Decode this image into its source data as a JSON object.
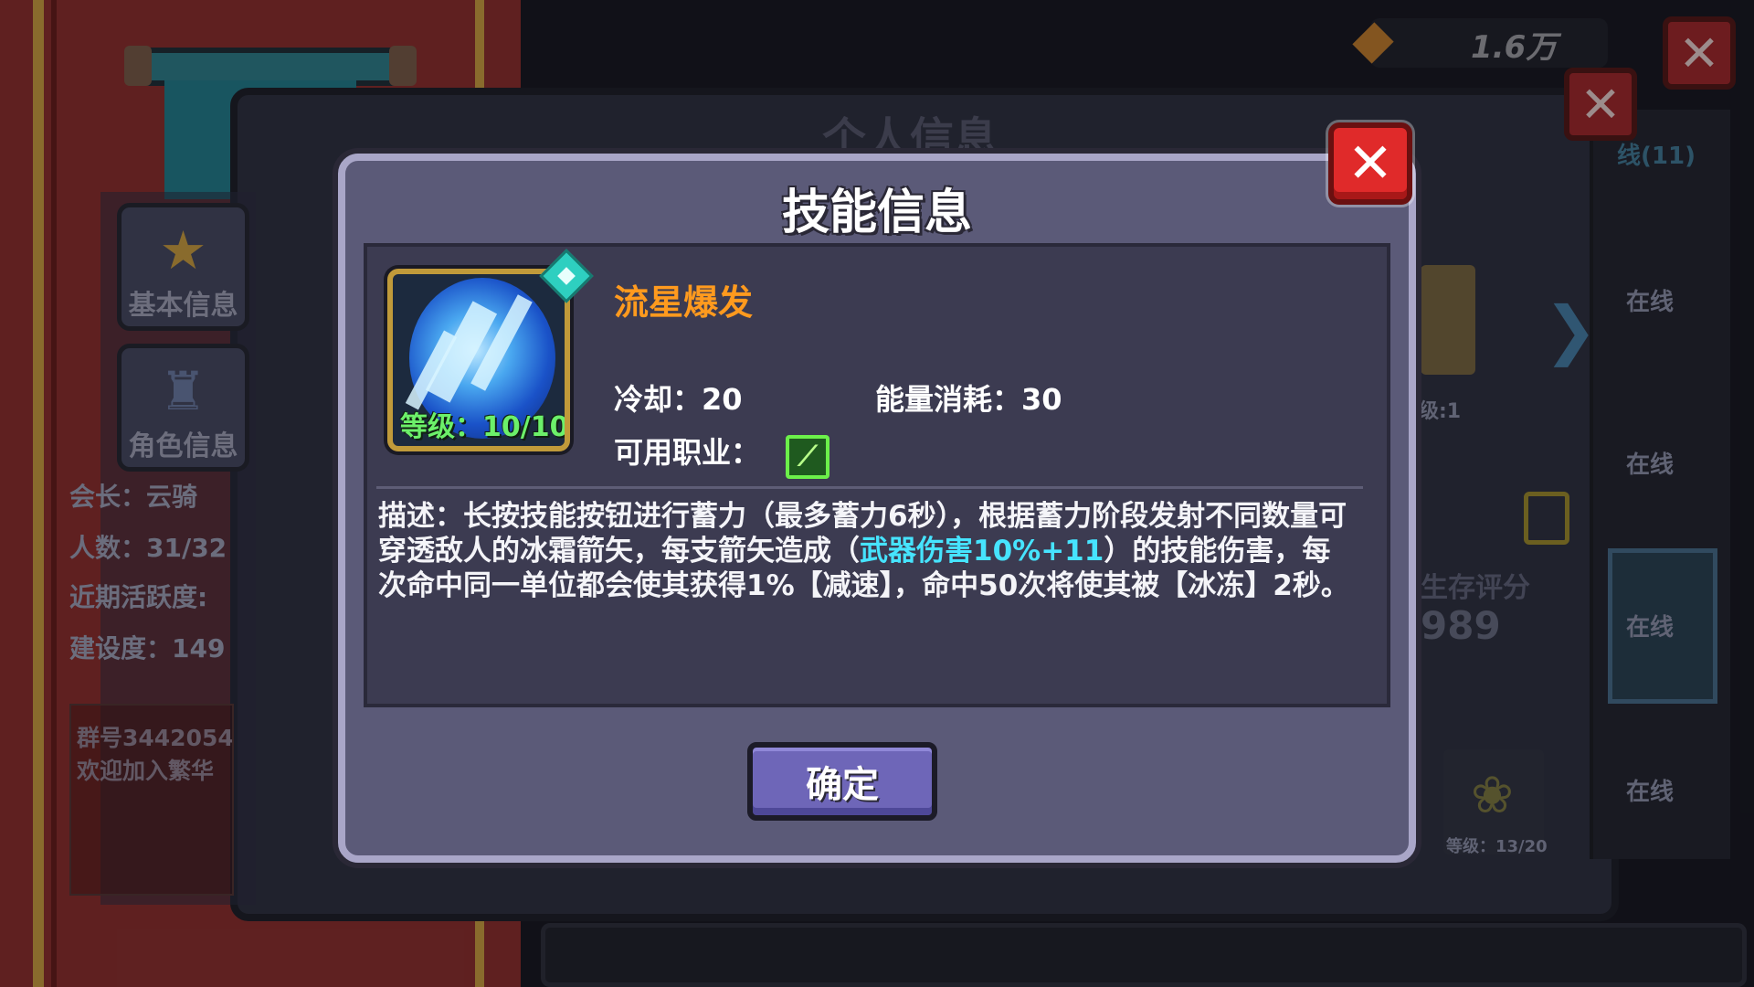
{
  "background": {
    "guild": {
      "side_buttons": [
        "基本信息",
        "角色信息"
      ],
      "leader": "会长：云骑",
      "members": "人数：31/32",
      "activity": "近期活跃度:",
      "construction": "建设度：149",
      "group_line1": "群号3442054",
      "group_line2": "欢迎加入繁华"
    },
    "personal_title": "个人信息",
    "gold_value": "1.6万",
    "close_glyph": "✕",
    "friend_count": "线(11)",
    "online_label": "在线",
    "level_stub": "级:1",
    "score_label": "生存评分",
    "score_value": "989",
    "item_level": "等级：13/20",
    "chevron": "❯"
  },
  "dialog": {
    "title": "技能信息",
    "skill": {
      "name": "流星爆发",
      "level": "等级：10/10",
      "icon": "meteor-burst-icon",
      "cooldown": "冷却：20",
      "energy": "能量消耗：30",
      "class_label": "可用职业：",
      "class_icon": "bow-class-icon"
    },
    "description": {
      "part1": "描述：长按技能按钮进行蓄力（最多蓄力6秒），根据蓄力阶段发射不同数量可穿透敌人的冰霜箭矢，每支箭矢造成（",
      "highlight": "武器伤害10%+11",
      "part2": "）的技能伤害，每次命中同一单位都会使其获得1%【减速】，命中50次将使其被【冰冻】2秒。"
    },
    "confirm_label": "确定",
    "close_glyph": "✕"
  },
  "colors": {
    "skill_name": "#ff9a1e",
    "highlight": "#46e4ff",
    "level_text": "#6cf06a",
    "close_red": "#e02a2a"
  }
}
